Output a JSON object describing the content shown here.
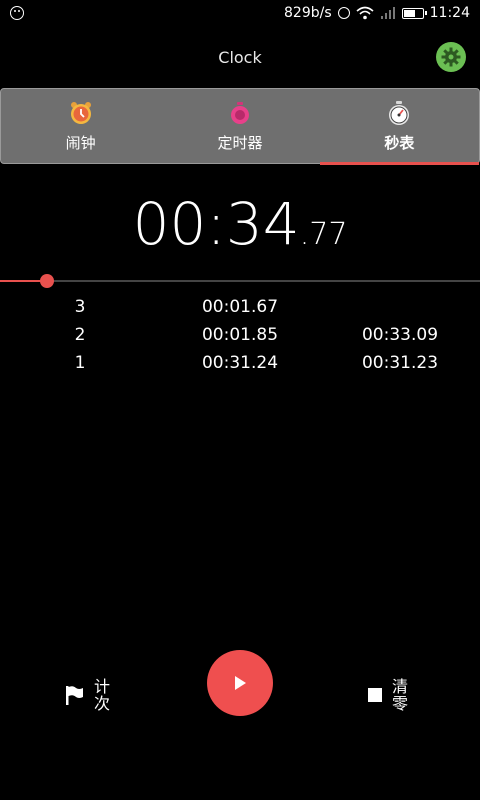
{
  "status_bar": {
    "network_speed": "829b/s",
    "time": "11:24",
    "battery_level": 0.65,
    "icons": [
      "notification-icon",
      "alarm-icon",
      "wifi-icon",
      "signal-icon",
      "battery-icon"
    ]
  },
  "header": {
    "title": "Clock",
    "settings_icon": "gear-icon",
    "settings_color": "#6bbf53"
  },
  "tabs": [
    {
      "label": "闹钟",
      "icon": "alarm-clock-icon",
      "active": false
    },
    {
      "label": "定时器",
      "icon": "timer-icon",
      "active": false
    },
    {
      "label": "秒表",
      "icon": "stopwatch-icon",
      "active": true
    }
  ],
  "stopwatch": {
    "elapsed_main": "00:34",
    "elapsed_hundredths": ".77",
    "progress": 0.097,
    "accent_color": "#e8514e"
  },
  "laps": [
    {
      "number": "3",
      "lap_time": "00:01.67",
      "total_time": ""
    },
    {
      "number": "2",
      "lap_time": "00:01.85",
      "total_time": "00:33.09"
    },
    {
      "number": "1",
      "lap_time": "00:31.24",
      "total_time": "00:31.23"
    }
  ],
  "controls": {
    "lap_label_1": "计",
    "lap_label_2": "次",
    "lap_icon": "flag-icon",
    "play_icon": "play-icon",
    "reset_label_1": "清",
    "reset_label_2": "零",
    "reset_icon": "stop-icon"
  }
}
